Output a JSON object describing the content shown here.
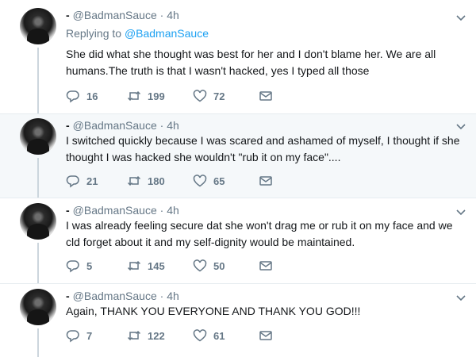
{
  "reply_context": {
    "prefix": "Replying to",
    "handle": "@BadmanSauce"
  },
  "tweets": [
    {
      "handle": "@BadmanSauce",
      "sep": "·",
      "time": "4h",
      "text": "She did what she thought was best for her and I don't blame her. We are all humans.The truth is that I wasn't hacked, yes I typed all those",
      "replies": "16",
      "retweets": "199",
      "likes": "72"
    },
    {
      "handle": "@BadmanSauce",
      "sep": "·",
      "time": "4h",
      "text": "I switched quickly because I was scared and ashamed of myself, I thought if she thought I was hacked she wouldn't \"rub it on my face\"....",
      "replies": "21",
      "retweets": "180",
      "likes": "65"
    },
    {
      "handle": "@BadmanSauce",
      "sep": "·",
      "time": "4h",
      "text": "I was already feeling secure dat she won't drag me or rub it on my face and we cld forget about it and my self-dignity would be maintained.",
      "replies": "5",
      "retweets": "145",
      "likes": "50"
    },
    {
      "handle": "@BadmanSauce",
      "sep": "·",
      "time": "4h",
      "text": "Again, THANK YOU EVERYONE AND THANK YOU GOD!!!",
      "replies": "7",
      "retweets": "122",
      "likes": "61"
    }
  ],
  "icons": {
    "reply": "reply-icon",
    "retweet": "retweet-icon",
    "like": "heart-icon",
    "dm": "envelope-icon",
    "menu": "chevron-down-icon"
  },
  "colors": {
    "accent": "#1da1f2",
    "muted": "#657786",
    "thread": "#ccd6dd",
    "highlight": "#f5f8fa"
  }
}
